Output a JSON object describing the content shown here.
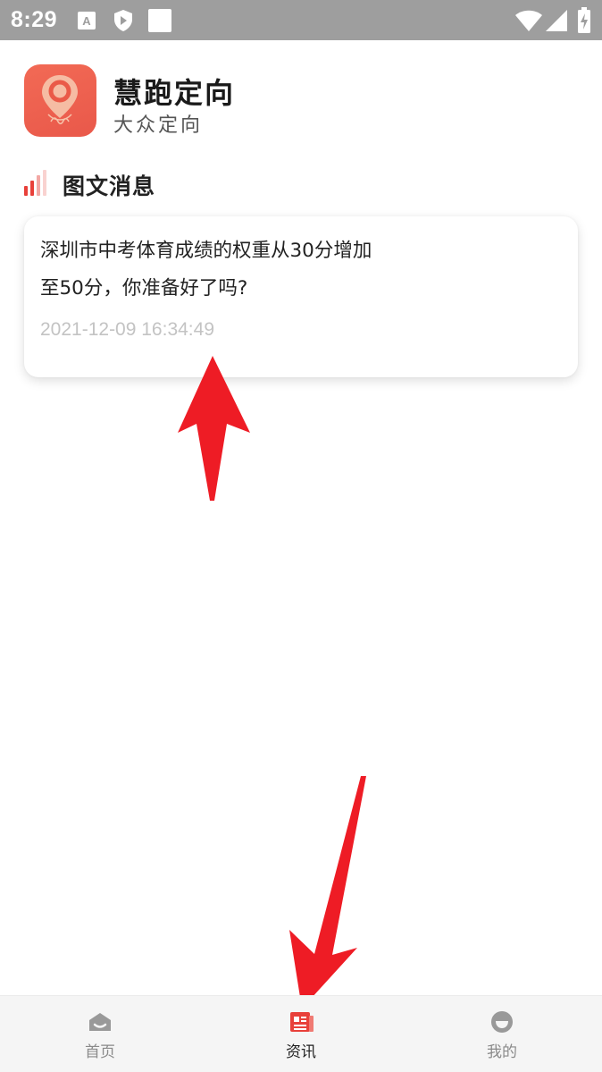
{
  "status_bar": {
    "time": "8:29"
  },
  "header": {
    "app_name": "慧跑定向",
    "subtitle": "大众定向"
  },
  "section": {
    "title": "图文消息"
  },
  "news": [
    {
      "title": "深圳市中考体育成绩的权重从30分增加至50分，你准备好了吗?",
      "time": "2021-12-09 16:34:49"
    }
  ],
  "bottom_nav": {
    "items": [
      {
        "label": "首页",
        "icon": "home-icon",
        "active": false
      },
      {
        "label": "资讯",
        "icon": "news-icon",
        "active": true
      },
      {
        "label": "我的",
        "icon": "profile-icon",
        "active": false
      }
    ]
  },
  "colors": {
    "accent": "#e8403a",
    "arrow": "#ee1c25",
    "status_bar": "#9e9e9e"
  }
}
